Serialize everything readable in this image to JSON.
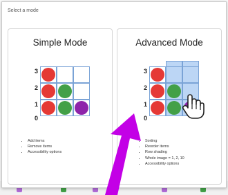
{
  "dialog": {
    "title": "Select a mode",
    "cards": [
      {
        "title": "Simple Mode",
        "y_labels": [
          "3",
          "2",
          "1",
          "0"
        ],
        "features": [
          "Add items",
          "Remove items",
          "Accessibility options"
        ]
      },
      {
        "title": "Advanced Mode",
        "y_labels": [
          "3",
          "2",
          "1",
          "0"
        ],
        "features": [
          "Sorting",
          "Reorder items",
          "Row shading",
          "Whole image = 1, 2, 10",
          "Accessibility options"
        ]
      }
    ]
  },
  "colors": {
    "red": "#e53935",
    "green": "#43a047",
    "purple": "#8e24aa",
    "highlight": "#bcd6f5",
    "grid_line": "#7aa3d6",
    "arrow": "#c300e6"
  },
  "icons": [
    "hand-cursor-icon",
    "arrow-pointer"
  ]
}
